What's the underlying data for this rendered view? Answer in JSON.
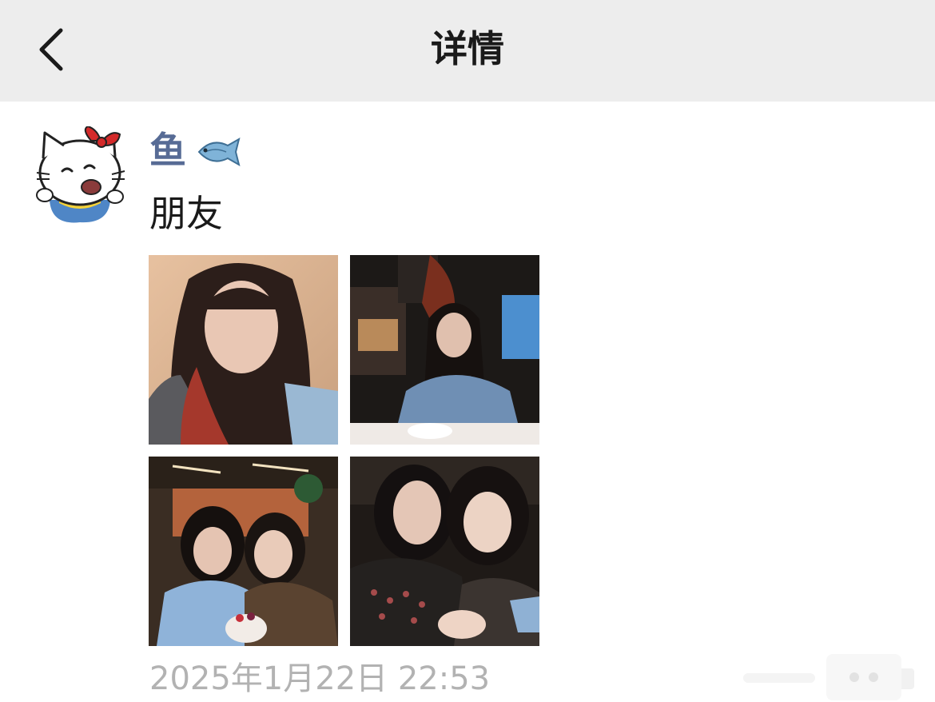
{
  "nav": {
    "title": "详情",
    "back_icon": "chevron-left-icon"
  },
  "post": {
    "author": "鱼",
    "author_emoji": "fish-icon",
    "caption": "朋友",
    "photos": [
      {
        "subject": "selfie-long-hair"
      },
      {
        "subject": "restaurant-seated"
      },
      {
        "subject": "two-friends-cake"
      },
      {
        "subject": "two-friends-close"
      }
    ],
    "timestamp": "2025年1月22日 22:53"
  },
  "colors": {
    "nav_bg": "#ededed",
    "author_link": "#576b95",
    "timestamp": "#b2b2b2"
  }
}
